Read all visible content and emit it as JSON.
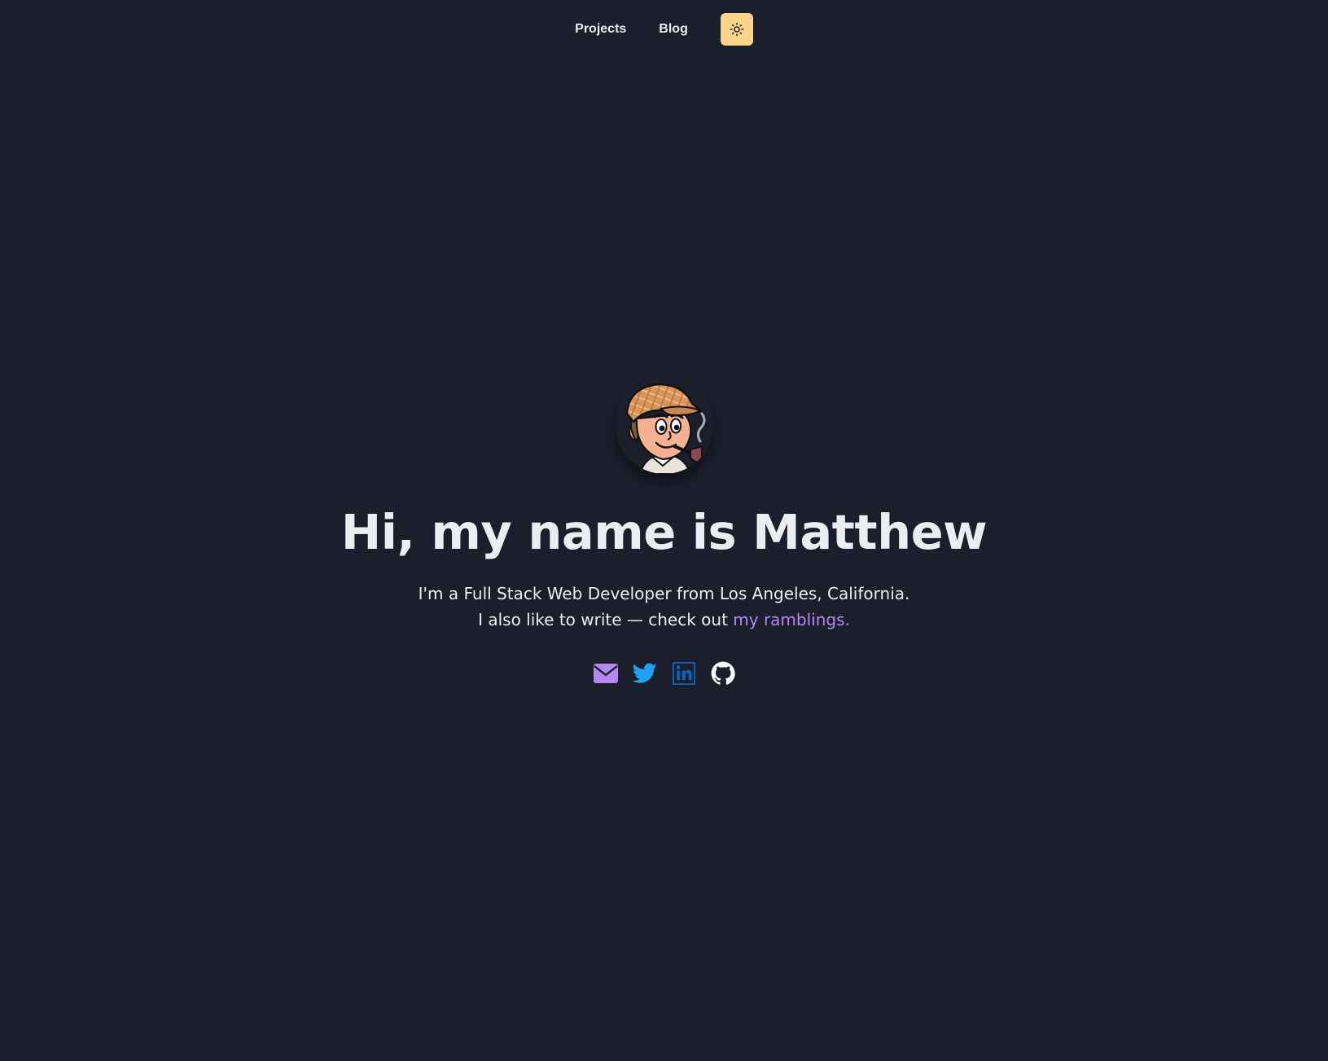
{
  "nav": {
    "items": [
      {
        "label": "Projects"
      },
      {
        "label": "Blog"
      }
    ],
    "theme_toggle_icon": "sun-icon",
    "theme_toggle_color": "#fdd58a"
  },
  "hero": {
    "avatar_icon": "detective-avatar",
    "headline": "Hi, my name is Matthew",
    "intro_line_1": "I'm a Full Stack Web Developer from Los Angeles, California.",
    "intro_line_2_prefix": "I also like to write — check out ",
    "intro_link": "my ramblings.",
    "accent_color": "#b587f0"
  },
  "socials": [
    {
      "icon": "mail-icon",
      "color": "#b587f0"
    },
    {
      "icon": "twitter-icon",
      "color": "#1da1f2"
    },
    {
      "icon": "linkedin-icon",
      "color": "#0a66c2"
    },
    {
      "icon": "github-icon",
      "color": "#ffffff"
    }
  ],
  "colors": {
    "background": "#1b1f2c",
    "text": "#ecedf0"
  }
}
